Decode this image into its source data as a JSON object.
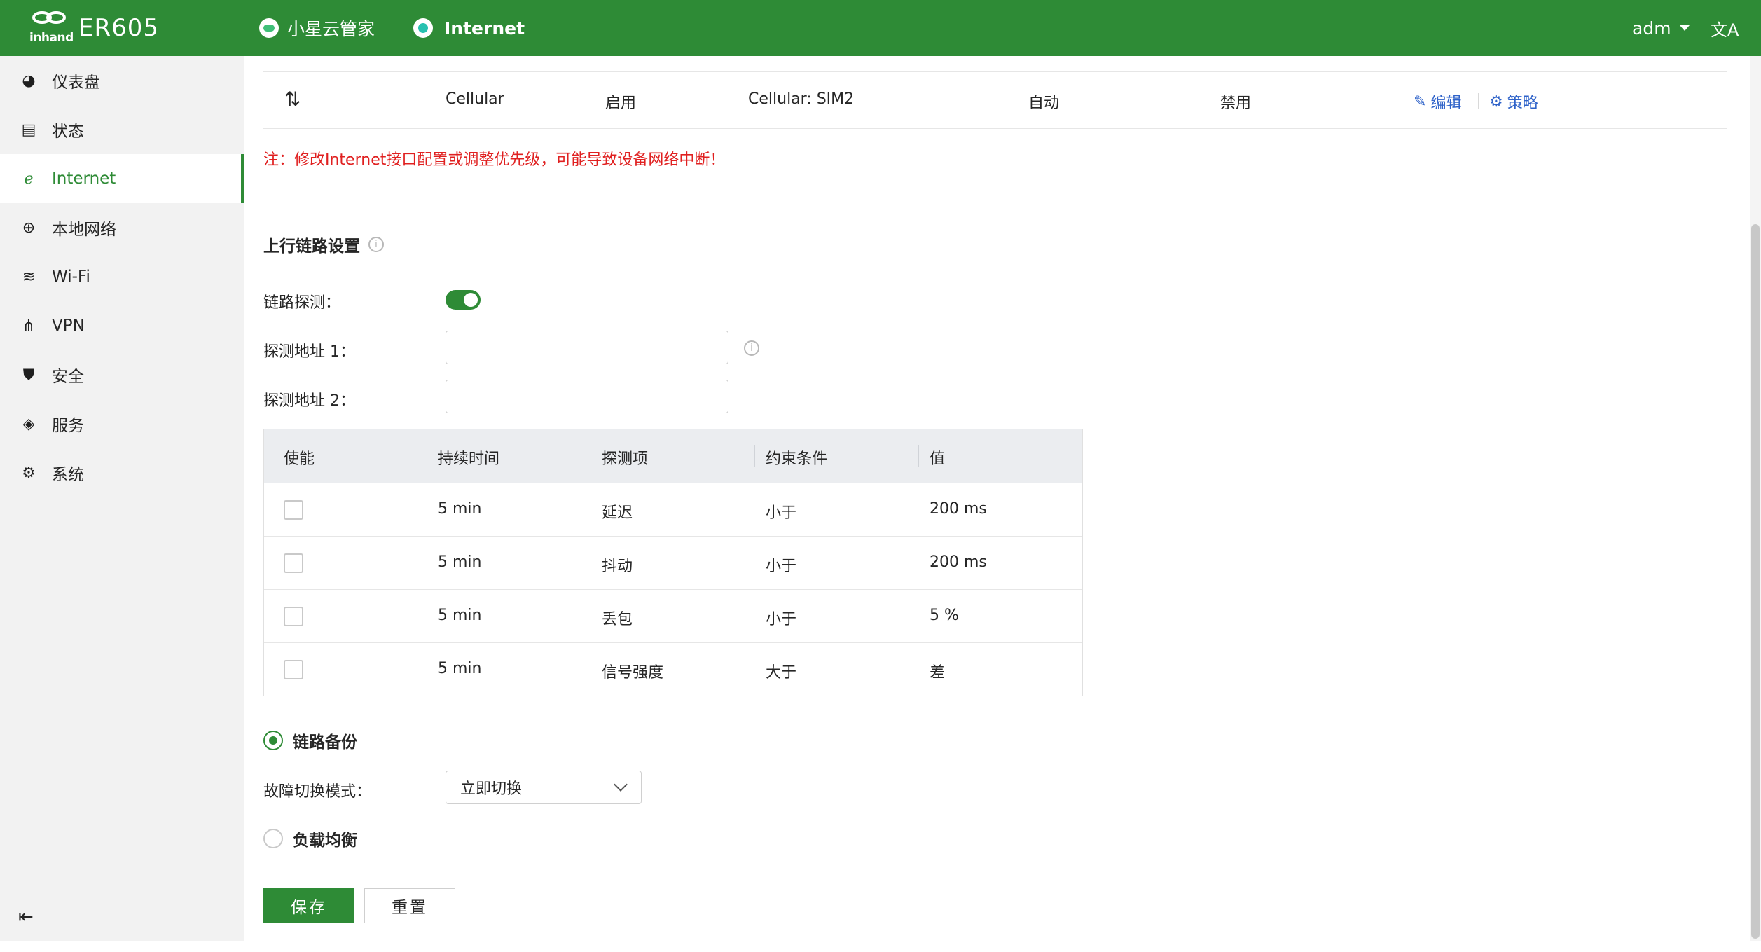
{
  "header": {
    "brand": "inhand",
    "model": "ER605",
    "cloud_label": "小星云管家",
    "internet_label": "Internet",
    "user": "adm",
    "lang_icon": "文A"
  },
  "sidebar": {
    "items": [
      {
        "label": "仪表盘",
        "icon": "dashboard-icon"
      },
      {
        "label": "状态",
        "icon": "status-icon"
      },
      {
        "label": "Internet",
        "icon": "internet-icon",
        "active": true
      },
      {
        "label": "本地网络",
        "icon": "globe-icon"
      },
      {
        "label": "Wi-Fi",
        "icon": "wifi-icon"
      },
      {
        "label": "VPN",
        "icon": "vpn-icon"
      },
      {
        "label": "安全",
        "icon": "shield-icon"
      },
      {
        "label": "服务",
        "icon": "cube-icon"
      },
      {
        "label": "系统",
        "icon": "gear-icon"
      }
    ]
  },
  "interface_row": {
    "name": "Cellular",
    "status": "启用",
    "detail": "Cellular: SIM2",
    "mode": "自动",
    "nat": "禁用",
    "edit_label": "编辑",
    "policy_label": "策略"
  },
  "note": "注：修改Internet接口配置或调整优先级，可能导致设备网络中断！",
  "uplink": {
    "title": "上行链路设置",
    "link_probe_label": "链路探测：",
    "link_probe_enabled": true,
    "probe_addr1_label": "探测地址 1：",
    "probe_addr1_value": "",
    "probe_addr2_label": "探测地址 2：",
    "probe_addr2_value": ""
  },
  "probe_table": {
    "headers": [
      "使能",
      "持续时间",
      "探测项",
      "约束条件",
      "值"
    ],
    "rows": [
      {
        "enabled": false,
        "duration": "5 min",
        "item": "延迟",
        "cond": "小于",
        "value": "200 ms"
      },
      {
        "enabled": false,
        "duration": "5 min",
        "item": "抖动",
        "cond": "小于",
        "value": "200 ms"
      },
      {
        "enabled": false,
        "duration": "5 min",
        "item": "丢包",
        "cond": "小于",
        "value": "5 %"
      },
      {
        "enabled": false,
        "duration": "5 min",
        "item": "信号强度",
        "cond": "大于",
        "value": "差"
      }
    ]
  },
  "backup": {
    "label": "链路备份",
    "selected": true,
    "failover_label": "故障切换模式：",
    "failover_value": "立即切换"
  },
  "load_balance": {
    "label": "负载均衡",
    "selected": false
  },
  "buttons": {
    "save": "保存",
    "reset": "重置"
  }
}
